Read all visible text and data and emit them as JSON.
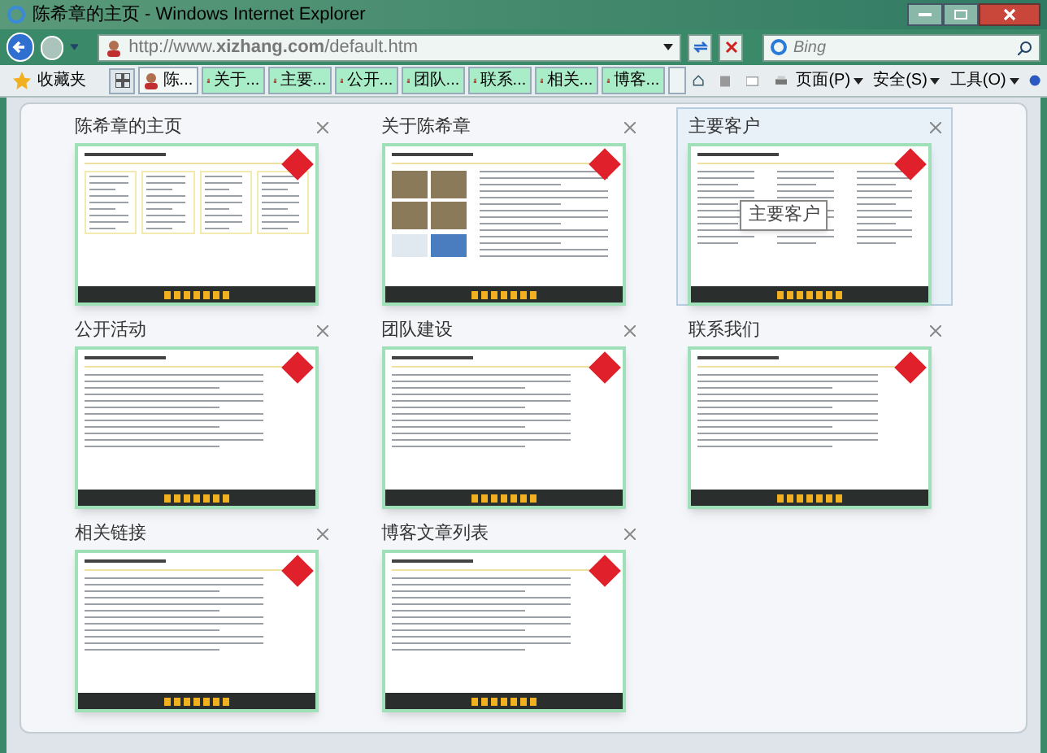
{
  "window": {
    "title": "陈希章的主页 - Windows Internet Explorer"
  },
  "address": {
    "url": "http://www.**xizhang.com**/default.htm"
  },
  "search": {
    "placeholder": "Bing"
  },
  "favorites": {
    "label": "收藏夹"
  },
  "tabs": [
    {
      "label": "陈...",
      "selected": true
    },
    {
      "label": "关于...",
      "selected": false
    },
    {
      "label": "主要...",
      "selected": false
    },
    {
      "label": "公开...",
      "selected": false
    },
    {
      "label": "团队...",
      "selected": false
    },
    {
      "label": "联系...",
      "selected": false
    },
    {
      "label": "相关...",
      "selected": false
    },
    {
      "label": "博客...",
      "selected": false
    }
  ],
  "commands": [
    {
      "label": "页面(P)"
    },
    {
      "label": "安全(S)"
    },
    {
      "label": "工具(O)"
    }
  ],
  "tiles": [
    {
      "title": "陈希章的主页",
      "hovered": false,
      "kind": "home"
    },
    {
      "title": "关于陈希章",
      "hovered": false,
      "kind": "photos"
    },
    {
      "title": "主要客户",
      "hovered": true,
      "kind": "list",
      "tooltip": "主要客户"
    },
    {
      "title": "公开活动",
      "hovered": false,
      "kind": "text"
    },
    {
      "title": "团队建设",
      "hovered": false,
      "kind": "text"
    },
    {
      "title": "联系我们",
      "hovered": false,
      "kind": "text"
    },
    {
      "title": "相关链接",
      "hovered": false,
      "kind": "text"
    },
    {
      "title": "博客文章列表",
      "hovered": false,
      "kind": "text"
    }
  ]
}
